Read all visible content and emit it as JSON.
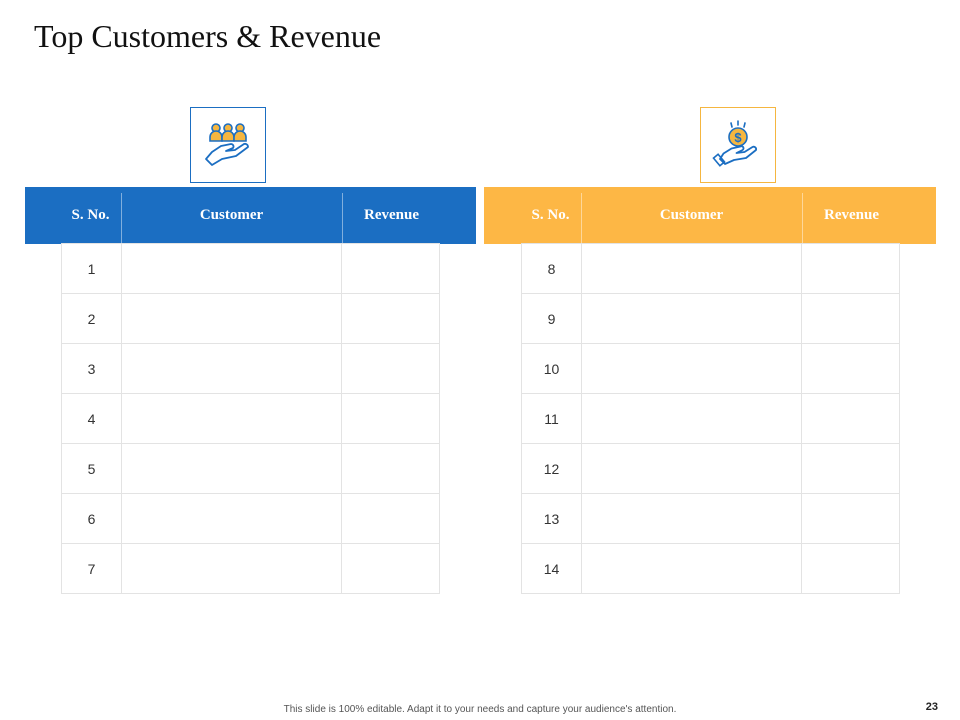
{
  "page": {
    "title": "Top Customers & Revenue"
  },
  "tables": [
    {
      "id": "left",
      "accent": "#1b6ec2",
      "icon": "people-in-hand-icon",
      "headers": {
        "sno": "S. No.",
        "customer": "Customer",
        "revenue": "Revenue"
      },
      "rows": [
        {
          "sno": "1",
          "customer": "",
          "revenue": ""
        },
        {
          "sno": "2",
          "customer": "",
          "revenue": ""
        },
        {
          "sno": "3",
          "customer": "",
          "revenue": ""
        },
        {
          "sno": "4",
          "customer": "",
          "revenue": ""
        },
        {
          "sno": "5",
          "customer": "",
          "revenue": ""
        },
        {
          "sno": "6",
          "customer": "",
          "revenue": ""
        },
        {
          "sno": "7",
          "customer": "",
          "revenue": ""
        }
      ]
    },
    {
      "id": "right",
      "accent": "#fdb745",
      "icon": "dollar-coin-in-hand-icon",
      "headers": {
        "sno": "S. No.",
        "customer": "Customer",
        "revenue": "Revenue"
      },
      "rows": [
        {
          "sno": "8",
          "customer": "",
          "revenue": ""
        },
        {
          "sno": "9",
          "customer": "",
          "revenue": ""
        },
        {
          "sno": "10",
          "customer": "",
          "revenue": ""
        },
        {
          "sno": "11",
          "customer": "",
          "revenue": ""
        },
        {
          "sno": "12",
          "customer": "",
          "revenue": ""
        },
        {
          "sno": "13",
          "customer": "",
          "revenue": ""
        },
        {
          "sno": "14",
          "customer": "",
          "revenue": ""
        }
      ]
    }
  ],
  "footer": {
    "note": "This slide is 100% editable. Adapt it to your needs and capture your audience's attention.",
    "page_number": "23"
  }
}
